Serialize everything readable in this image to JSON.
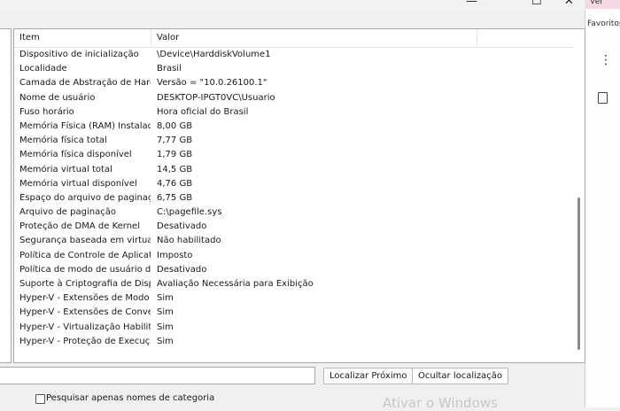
{
  "browser": {
    "user_fragment": "ver",
    "favorites_label": "Favoritos"
  },
  "window_controls": {
    "minimize": "—",
    "maximize": "☐",
    "close": "✕"
  },
  "columns": [
    "Item",
    "Valor"
  ],
  "rows": [
    {
      "item": "Dispositivo de inicialização",
      "value": "\\Device\\HarddiskVolume1"
    },
    {
      "item": "Localidade",
      "value": "Brasil"
    },
    {
      "item": "Camada de Abstração de Hard...",
      "value": "Versão = \"10.0.26100.1\""
    },
    {
      "item": "Nome de usuário",
      "value": "DESKTOP-IPGT0VC\\Usuario"
    },
    {
      "item": "Fuso horário",
      "value": "Hora oficial do Brasil"
    },
    {
      "item": "Memória Física (RAM) Instalada",
      "value": "8,00 GB"
    },
    {
      "item": "Memória física total",
      "value": "7,77 GB"
    },
    {
      "item": "Memória física disponível",
      "value": "1,79 GB"
    },
    {
      "item": "Memória virtual total",
      "value": "14,5 GB"
    },
    {
      "item": "Memória virtual disponível",
      "value": "4,76 GB"
    },
    {
      "item": "Espaço do arquivo de paginaç...",
      "value": "6,75 GB"
    },
    {
      "item": "Arquivo de paginação",
      "value": "C:\\pagefile.sys"
    },
    {
      "item": "Proteção de DMA de Kernel",
      "value": "Desativado"
    },
    {
      "item": "Segurança baseada em virtuali...",
      "value": "Não habilitado"
    },
    {
      "item": "Política de Controle de Aplicati...",
      "value": "Imposto"
    },
    {
      "item": "Política de modo de usuário d...",
      "value": "Desativado"
    },
    {
      "item": "Suporte à Criptografia de Disp...",
      "value": "Avaliação Necessária para Exibição"
    },
    {
      "item": "Hyper-V - Extensões de Modo ...",
      "value": "Sim"
    },
    {
      "item": "Hyper-V - Extensões de Conver...",
      "value": "Sim"
    },
    {
      "item": "Hyper-V - Virtualização Habilita...",
      "value": "Sim"
    },
    {
      "item": "Hyper-V - Proteção de Execuçã...",
      "value": "Sim"
    }
  ],
  "search": {
    "value": "",
    "find_next_label": "Localizar Próximo",
    "hide_find_label": "Ocultar localização"
  },
  "category_checkbox_label": "Pesquisar apenas nomes de categoria",
  "watermark": "Ativar o Windows"
}
